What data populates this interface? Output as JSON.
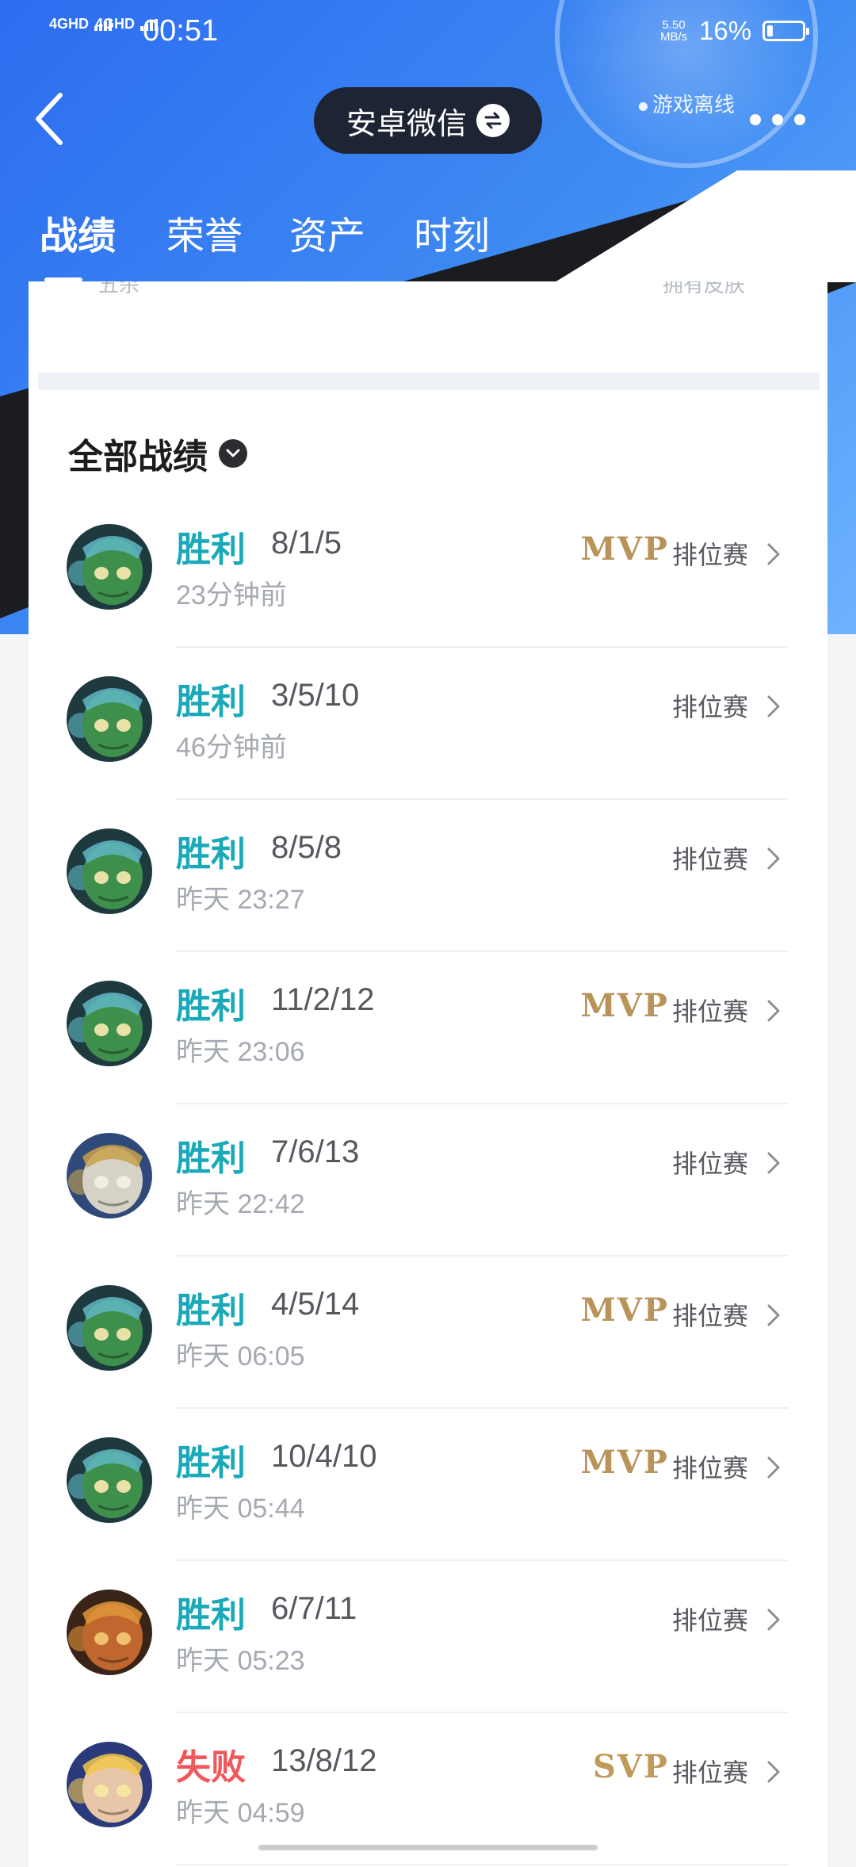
{
  "status_bar": {
    "network_1": "4GHD",
    "network_2": "4GHD",
    "time": "00:51",
    "speed_value": "5.50",
    "speed_unit": "MB/s",
    "battery_pct": "16%",
    "battery_level": 0.16
  },
  "nav": {
    "account_label": "安卓微信",
    "offline_label": "游戏离线"
  },
  "tabs": [
    {
      "label": "战绩"
    },
    {
      "label": "荣誉"
    },
    {
      "label": "资产"
    },
    {
      "label": "时刻"
    }
  ],
  "stats_partial": {
    "left": "五杀",
    "right": "拥有皮肤"
  },
  "section": {
    "title": "全部战绩"
  },
  "matches": [
    {
      "result": "胜利",
      "kda": "8/1/5",
      "time": "23分钟前",
      "badge": "MVP",
      "mode": "排位赛",
      "hero": "green"
    },
    {
      "result": "胜利",
      "kda": "3/5/10",
      "time": "46分钟前",
      "badge": "",
      "mode": "排位赛",
      "hero": "green"
    },
    {
      "result": "胜利",
      "kda": "8/5/8",
      "time": "昨天 23:27",
      "badge": "",
      "mode": "排位赛",
      "hero": "green"
    },
    {
      "result": "胜利",
      "kda": "11/2/12",
      "time": "昨天 23:06",
      "badge": "MVP",
      "mode": "排位赛",
      "hero": "green"
    },
    {
      "result": "胜利",
      "kda": "7/6/13",
      "time": "昨天 22:42",
      "badge": "",
      "mode": "排位赛",
      "hero": "silver"
    },
    {
      "result": "胜利",
      "kda": "4/5/14",
      "time": "昨天 06:05",
      "badge": "MVP",
      "mode": "排位赛",
      "hero": "green"
    },
    {
      "result": "胜利",
      "kda": "10/4/10",
      "time": "昨天 05:44",
      "badge": "MVP",
      "mode": "排位赛",
      "hero": "green"
    },
    {
      "result": "胜利",
      "kda": "6/7/11",
      "time": "昨天 05:23",
      "badge": "",
      "mode": "排位赛",
      "hero": "red"
    },
    {
      "result": "失败",
      "kda": "13/8/12",
      "time": "昨天 04:59",
      "badge": "SVP",
      "mode": "排位赛",
      "hero": "blue"
    }
  ],
  "colors": {
    "win": "#1aa9b9",
    "lose": "#f0585b",
    "badge_gold": "#b8935a",
    "header_blue": "#2d6cf0"
  }
}
